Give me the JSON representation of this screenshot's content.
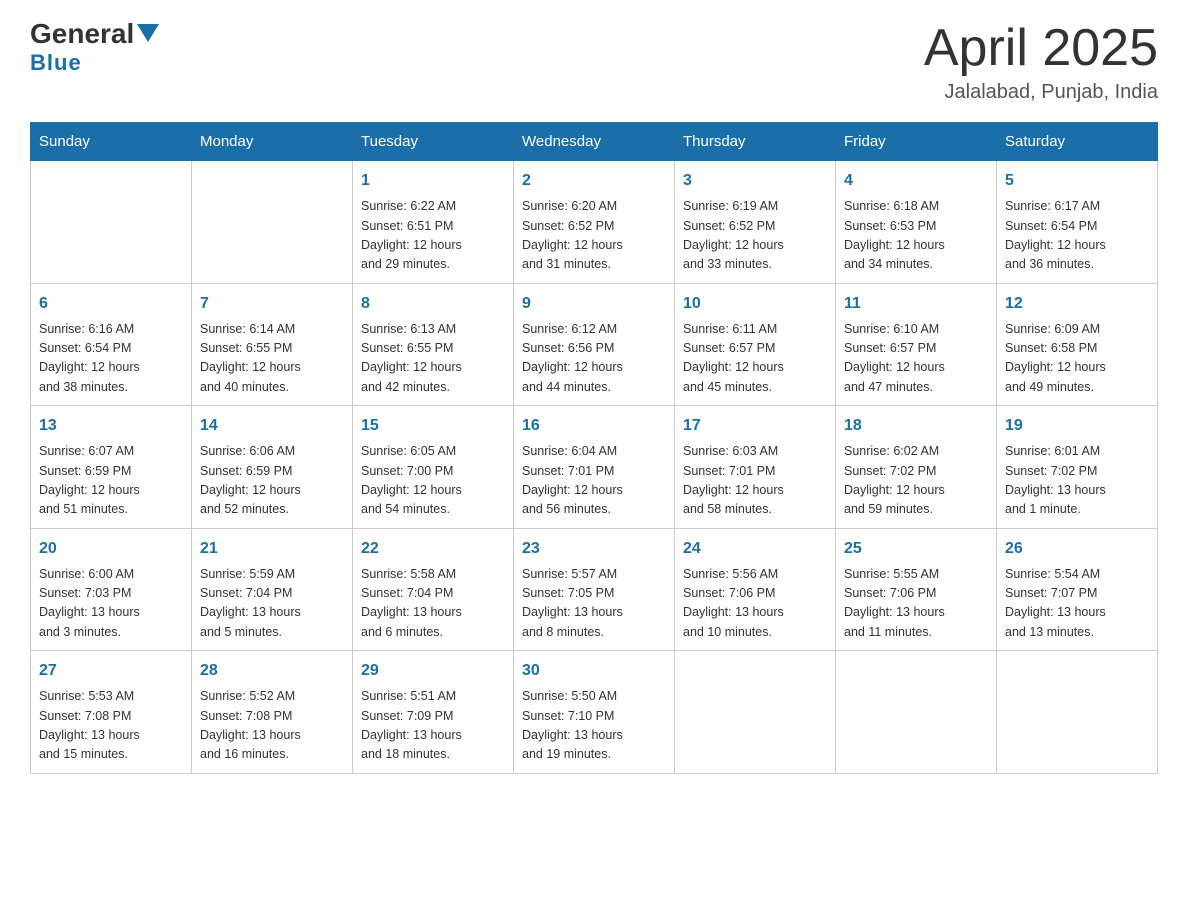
{
  "header": {
    "logo_general": "General",
    "logo_blue": "Blue",
    "month_year": "April 2025",
    "location": "Jalalabad, Punjab, India"
  },
  "weekdays": [
    "Sunday",
    "Monday",
    "Tuesday",
    "Wednesday",
    "Thursday",
    "Friday",
    "Saturday"
  ],
  "weeks": [
    [
      {
        "day": "",
        "info": ""
      },
      {
        "day": "",
        "info": ""
      },
      {
        "day": "1",
        "info": "Sunrise: 6:22 AM\nSunset: 6:51 PM\nDaylight: 12 hours\nand 29 minutes."
      },
      {
        "day": "2",
        "info": "Sunrise: 6:20 AM\nSunset: 6:52 PM\nDaylight: 12 hours\nand 31 minutes."
      },
      {
        "day": "3",
        "info": "Sunrise: 6:19 AM\nSunset: 6:52 PM\nDaylight: 12 hours\nand 33 minutes."
      },
      {
        "day": "4",
        "info": "Sunrise: 6:18 AM\nSunset: 6:53 PM\nDaylight: 12 hours\nand 34 minutes."
      },
      {
        "day": "5",
        "info": "Sunrise: 6:17 AM\nSunset: 6:54 PM\nDaylight: 12 hours\nand 36 minutes."
      }
    ],
    [
      {
        "day": "6",
        "info": "Sunrise: 6:16 AM\nSunset: 6:54 PM\nDaylight: 12 hours\nand 38 minutes."
      },
      {
        "day": "7",
        "info": "Sunrise: 6:14 AM\nSunset: 6:55 PM\nDaylight: 12 hours\nand 40 minutes."
      },
      {
        "day": "8",
        "info": "Sunrise: 6:13 AM\nSunset: 6:55 PM\nDaylight: 12 hours\nand 42 minutes."
      },
      {
        "day": "9",
        "info": "Sunrise: 6:12 AM\nSunset: 6:56 PM\nDaylight: 12 hours\nand 44 minutes."
      },
      {
        "day": "10",
        "info": "Sunrise: 6:11 AM\nSunset: 6:57 PM\nDaylight: 12 hours\nand 45 minutes."
      },
      {
        "day": "11",
        "info": "Sunrise: 6:10 AM\nSunset: 6:57 PM\nDaylight: 12 hours\nand 47 minutes."
      },
      {
        "day": "12",
        "info": "Sunrise: 6:09 AM\nSunset: 6:58 PM\nDaylight: 12 hours\nand 49 minutes."
      }
    ],
    [
      {
        "day": "13",
        "info": "Sunrise: 6:07 AM\nSunset: 6:59 PM\nDaylight: 12 hours\nand 51 minutes."
      },
      {
        "day": "14",
        "info": "Sunrise: 6:06 AM\nSunset: 6:59 PM\nDaylight: 12 hours\nand 52 minutes."
      },
      {
        "day": "15",
        "info": "Sunrise: 6:05 AM\nSunset: 7:00 PM\nDaylight: 12 hours\nand 54 minutes."
      },
      {
        "day": "16",
        "info": "Sunrise: 6:04 AM\nSunset: 7:01 PM\nDaylight: 12 hours\nand 56 minutes."
      },
      {
        "day": "17",
        "info": "Sunrise: 6:03 AM\nSunset: 7:01 PM\nDaylight: 12 hours\nand 58 minutes."
      },
      {
        "day": "18",
        "info": "Sunrise: 6:02 AM\nSunset: 7:02 PM\nDaylight: 12 hours\nand 59 minutes."
      },
      {
        "day": "19",
        "info": "Sunrise: 6:01 AM\nSunset: 7:02 PM\nDaylight: 13 hours\nand 1 minute."
      }
    ],
    [
      {
        "day": "20",
        "info": "Sunrise: 6:00 AM\nSunset: 7:03 PM\nDaylight: 13 hours\nand 3 minutes."
      },
      {
        "day": "21",
        "info": "Sunrise: 5:59 AM\nSunset: 7:04 PM\nDaylight: 13 hours\nand 5 minutes."
      },
      {
        "day": "22",
        "info": "Sunrise: 5:58 AM\nSunset: 7:04 PM\nDaylight: 13 hours\nand 6 minutes."
      },
      {
        "day": "23",
        "info": "Sunrise: 5:57 AM\nSunset: 7:05 PM\nDaylight: 13 hours\nand 8 minutes."
      },
      {
        "day": "24",
        "info": "Sunrise: 5:56 AM\nSunset: 7:06 PM\nDaylight: 13 hours\nand 10 minutes."
      },
      {
        "day": "25",
        "info": "Sunrise: 5:55 AM\nSunset: 7:06 PM\nDaylight: 13 hours\nand 11 minutes."
      },
      {
        "day": "26",
        "info": "Sunrise: 5:54 AM\nSunset: 7:07 PM\nDaylight: 13 hours\nand 13 minutes."
      }
    ],
    [
      {
        "day": "27",
        "info": "Sunrise: 5:53 AM\nSunset: 7:08 PM\nDaylight: 13 hours\nand 15 minutes."
      },
      {
        "day": "28",
        "info": "Sunrise: 5:52 AM\nSunset: 7:08 PM\nDaylight: 13 hours\nand 16 minutes."
      },
      {
        "day": "29",
        "info": "Sunrise: 5:51 AM\nSunset: 7:09 PM\nDaylight: 13 hours\nand 18 minutes."
      },
      {
        "day": "30",
        "info": "Sunrise: 5:50 AM\nSunset: 7:10 PM\nDaylight: 13 hours\nand 19 minutes."
      },
      {
        "day": "",
        "info": ""
      },
      {
        "day": "",
        "info": ""
      },
      {
        "day": "",
        "info": ""
      }
    ]
  ]
}
